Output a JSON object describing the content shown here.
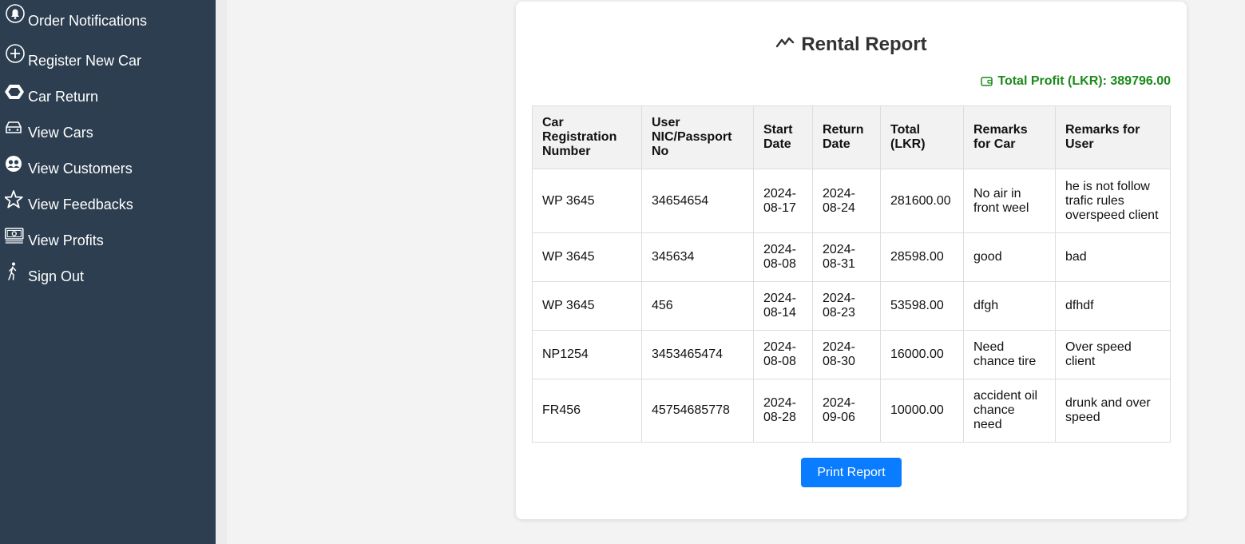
{
  "sidebar": {
    "items": [
      {
        "label": "Order Notifications",
        "icon": "bell-icon"
      },
      {
        "label": "Register New Car",
        "icon": "plus-circle-icon"
      },
      {
        "label": "Car Return",
        "icon": "hexagon-icon"
      },
      {
        "label": "View Cars",
        "icon": "car-icon"
      },
      {
        "label": "View Customers",
        "icon": "people-icon"
      },
      {
        "label": "View Feedbacks",
        "icon": "star-icon"
      },
      {
        "label": "View Profits",
        "icon": "cash-icon"
      },
      {
        "label": "Sign Out",
        "icon": "walking-person-icon"
      }
    ]
  },
  "report": {
    "title": "Rental Report",
    "title_icon": "line-chart-icon",
    "profit_label": "Total Profit (LKR): 389796.00",
    "profit_icon": "wallet-icon",
    "profit_color": "#1a8a1a",
    "headers": [
      "Car Registration Number",
      "User NIC/Passport No",
      "Start Date",
      "Return Date",
      "Total (LKR)",
      "Remarks for Car",
      "Remarks for User"
    ],
    "rows": [
      [
        "WP 3645",
        "34654654",
        "2024-08-17",
        "2024-08-24",
        "281600.00",
        "No air in front weel",
        "he is not follow trafic rules overspeed client"
      ],
      [
        "WP 3645",
        "345634",
        "2024-08-08",
        "2024-08-31",
        "28598.00",
        "good",
        "bad"
      ],
      [
        "WP 3645",
        "456",
        "2024-08-14",
        "2024-08-23",
        "53598.00",
        "dfgh",
        "dfhdf"
      ],
      [
        "NP1254",
        "3453465474",
        "2024-08-08",
        "2024-08-30",
        "16000.00",
        "Need chance tire",
        "Over speed client"
      ],
      [
        "FR456",
        "45754685778",
        "2024-08-28",
        "2024-09-06",
        "10000.00",
        "accident oil chance need",
        "drunk and over speed"
      ]
    ],
    "print_button": "Print Report",
    "button_color": "#0a7cff"
  }
}
